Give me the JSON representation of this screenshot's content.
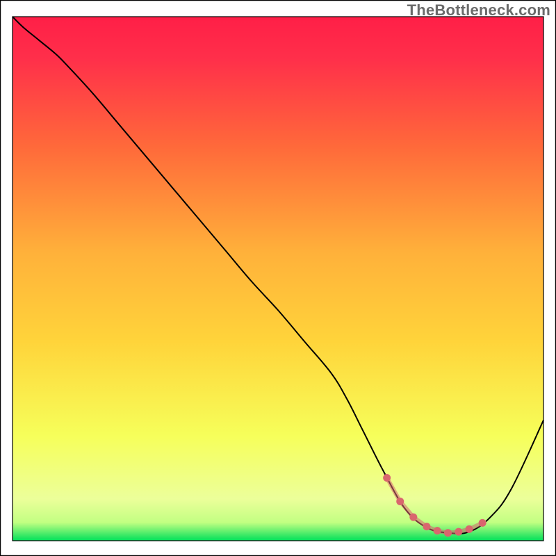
{
  "watermark": "TheBottleneck.com",
  "colors": {
    "grad_top": "#ff1f47",
    "grad_upper_mid": "#ff6a3a",
    "grad_mid": "#ffd43a",
    "grad_lower_mid": "#f6ff5a",
    "grad_bottom_highlight": "#ecff9a",
    "grad_bottom": "#00e05a",
    "curve_stroke": "#000000",
    "valley_stroke": "#d9666e",
    "frame_stroke": "#000000"
  },
  "chart_data": {
    "type": "line",
    "title": "",
    "xlabel": "",
    "ylabel": "",
    "xlim": [
      0,
      100
    ],
    "ylim": [
      0,
      100
    ],
    "legend": false,
    "grid": false,
    "series": [
      {
        "name": "bottleneck-curve",
        "x": [
          0,
          2,
          5,
          8,
          10,
          15,
          20,
          25,
          30,
          35,
          40,
          45,
          50,
          55,
          60,
          63,
          66,
          70,
          74,
          78,
          82,
          86,
          90,
          94,
          100
        ],
        "y": [
          100,
          98,
          95.5,
          93,
          91,
          85.5,
          79.5,
          73.5,
          67.5,
          61.5,
          55.5,
          49.5,
          44,
          38,
          32,
          27,
          21,
          13,
          6,
          2.5,
          1.5,
          1.7,
          4.5,
          10,
          23
        ]
      },
      {
        "name": "optimal-valley-markers",
        "x": [
          70.5,
          73,
          75.5,
          78,
          80,
          82,
          84,
          86,
          88.5
        ],
        "y": [
          12,
          7.5,
          4.5,
          2.7,
          1.9,
          1.5,
          1.7,
          2.2,
          3.4
        ]
      }
    ],
    "annotations": [
      {
        "text": "TheBottleneck.com",
        "position": "top-right"
      }
    ],
    "notes": "Background is a vertical rainbow gradient (red→yellow→green). Black curve descends from 100% at x=0 to a minimum ~1.5 near x≈82, then rises. Pink dotted markers highlight the optimal valley region."
  }
}
